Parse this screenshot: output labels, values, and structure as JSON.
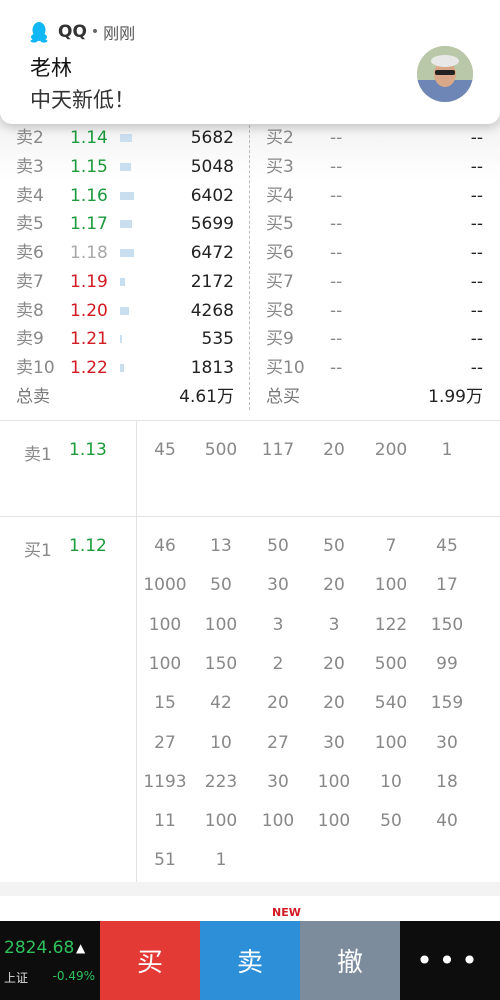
{
  "notification": {
    "app_name": "QQ",
    "separator": "•",
    "time": "刚刚",
    "sender": "老林",
    "message": "中天新低！"
  },
  "order_book": {
    "sell_rows": [
      {
        "label": "卖2",
        "price": "1.14",
        "qty": "5682",
        "price_color": "green",
        "bar": 0.5
      },
      {
        "label": "卖3",
        "price": "1.15",
        "qty": "5048",
        "price_color": "green",
        "bar": 0.45
      },
      {
        "label": "卖4",
        "price": "1.16",
        "qty": "6402",
        "price_color": "green",
        "bar": 0.57
      },
      {
        "label": "卖5",
        "price": "1.17",
        "qty": "5699",
        "price_color": "green",
        "bar": 0.5
      },
      {
        "label": "卖6",
        "price": "1.18",
        "qty": "6472",
        "price_color": "grey",
        "bar": 0.58
      },
      {
        "label": "卖7",
        "price": "1.19",
        "qty": "2172",
        "price_color": "red",
        "bar": 0.2
      },
      {
        "label": "卖8",
        "price": "1.20",
        "qty": "4268",
        "price_color": "red",
        "bar": 0.38
      },
      {
        "label": "卖9",
        "price": "1.21",
        "qty": "535",
        "price_color": "red",
        "bar": 0.05
      },
      {
        "label": "卖10",
        "price": "1.22",
        "qty": "1813",
        "price_color": "red",
        "bar": 0.16
      }
    ],
    "buy_rows": [
      {
        "label": "买2",
        "price": "--",
        "qty": "--"
      },
      {
        "label": "买3",
        "price": "--",
        "qty": "--"
      },
      {
        "label": "买4",
        "price": "--",
        "qty": "--"
      },
      {
        "label": "买5",
        "price": "--",
        "qty": "--"
      },
      {
        "label": "买6",
        "price": "--",
        "qty": "--"
      },
      {
        "label": "买7",
        "price": "--",
        "qty": "--"
      },
      {
        "label": "买8",
        "price": "--",
        "qty": "--"
      },
      {
        "label": "买9",
        "price": "--",
        "qty": "--"
      },
      {
        "label": "买10",
        "price": "--",
        "qty": "--"
      }
    ],
    "total_sell_label": "总卖",
    "total_sell_value": "4.61万",
    "total_buy_label": "总买",
    "total_buy_value": "1.99万"
  },
  "queue": {
    "sell1": {
      "label": "卖1",
      "price": "1.13",
      "rows": [
        [
          "45",
          "500",
          "117",
          "20",
          "200",
          "1"
        ]
      ]
    },
    "buy1": {
      "label": "买1",
      "price": "1.12",
      "rows": [
        [
          "46",
          "13",
          "50",
          "50",
          "7",
          "45"
        ],
        [
          "1000",
          "50",
          "30",
          "20",
          "100",
          "17"
        ],
        [
          "100",
          "100",
          "3",
          "3",
          "122",
          "150"
        ],
        [
          "100",
          "150",
          "2",
          "20",
          "500",
          "99"
        ],
        [
          "15",
          "42",
          "20",
          "20",
          "540",
          "159"
        ],
        [
          "27",
          "10",
          "27",
          "30",
          "100",
          "30"
        ],
        [
          "1193",
          "223",
          "30",
          "100",
          "10",
          "18"
        ],
        [
          "11",
          "100",
          "100",
          "100",
          "50",
          "40"
        ],
        [
          "51",
          "1"
        ]
      ]
    }
  },
  "tabs": {
    "badge": "NEW"
  },
  "bottom_bar": {
    "index_value": "2824.68",
    "index_arrow": "▲",
    "index_name": "上证",
    "index_change": "-0.49%",
    "buy_label": "买",
    "sell_label": "卖",
    "cancel_label": "撤",
    "more_label": "•••"
  },
  "colors": {
    "green": "#1b9a3c",
    "red": "#d21a23",
    "grey": "#a8a8a8",
    "buy_button": "#e43a36",
    "sell_button": "#2e8fd9",
    "cancel_button": "#7c8c9d"
  }
}
